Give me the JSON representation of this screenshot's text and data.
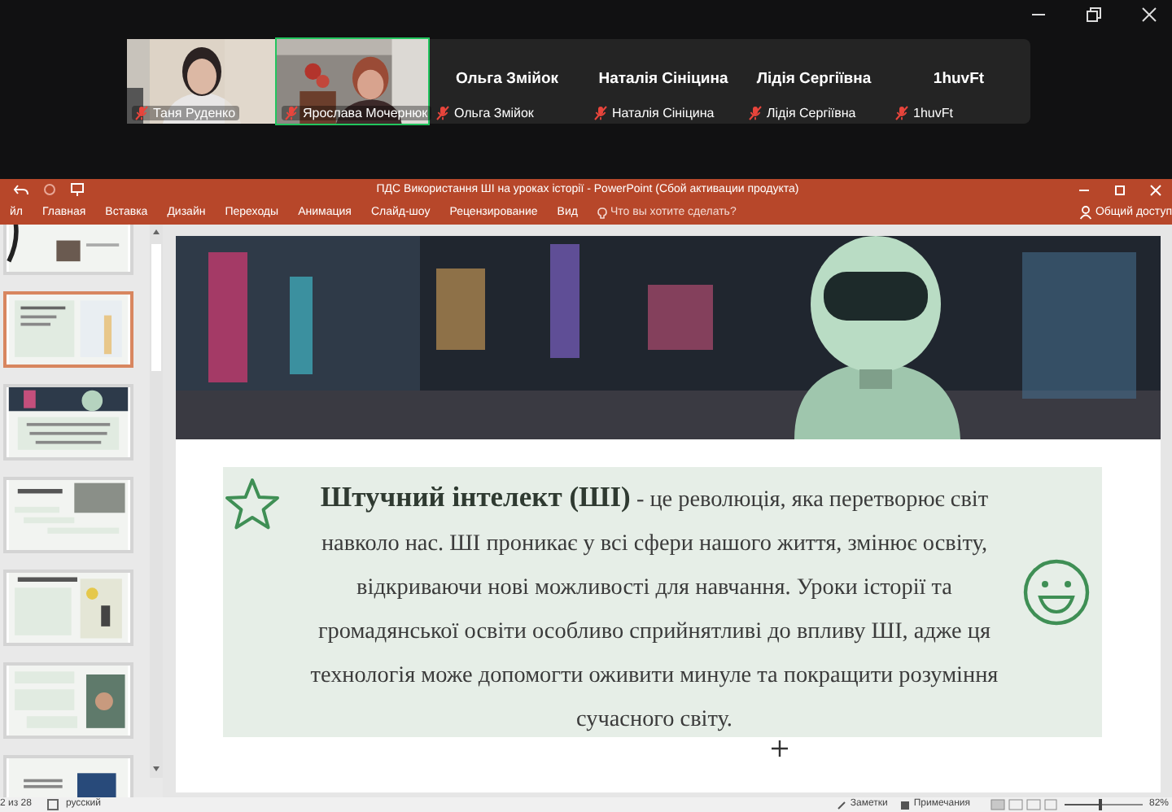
{
  "participants": [
    {
      "kind": "video",
      "name": "Таня Руденко",
      "muted": true,
      "selected": false
    },
    {
      "kind": "video",
      "name": "Ярослава Мочернюк",
      "muted": true,
      "selected": true
    },
    {
      "kind": "name",
      "display_name": "Ольга Змійок",
      "name": "Ольга Змійок",
      "muted": true,
      "selected": false
    },
    {
      "kind": "name",
      "display_name": "Наталія Сініцина",
      "name": "Наталія Сініцина",
      "muted": true,
      "selected": false
    },
    {
      "kind": "name",
      "display_name": "Лідія Сергіївна",
      "name": "Лідія Сергіївна",
      "muted": true,
      "selected": false
    },
    {
      "kind": "name",
      "display_name": "1huvFt",
      "name": "1huvFt",
      "muted": true,
      "selected": false
    }
  ],
  "window": {
    "title": "ПДС Використання ШІ на уроках історії - PowerPoint (Сбой активации продукта)"
  },
  "ribbon": {
    "tabs": [
      "йл",
      "Главная",
      "Вставка",
      "Дизайн",
      "Переходы",
      "Анимация",
      "Слайд-шоу",
      "Рецензирование",
      "Вид"
    ],
    "tell_me": "Что вы хотите сделать?",
    "share": "Общий доступ"
  },
  "thumbnails": [
    {
      "selected": false
    },
    {
      "selected": true
    },
    {
      "selected": false
    },
    {
      "selected": false
    },
    {
      "selected": false
    },
    {
      "selected": false
    },
    {
      "selected": false
    }
  ],
  "slide": {
    "text": "**Штучний інтелект (ШІ)** - це революція, яка перетворює світ навколо нас. ШІ проникає у всі сфери нашого життя, змінює освіту, відкриваючи нові можливості для навчання. Уроки історії та громадянської освіти особливо сприйнятливі до впливу ШІ, адже ця технологія може допомогти оживити минуле та покращити розуміння сучасного світу."
  },
  "status_bar": {
    "slide_count": "2 из 28",
    "language": "русский",
    "notes": "Заметки",
    "comments": "Примечания",
    "zoom": "82%",
    "zoom_slider": {
      "level": 0.45
    }
  }
}
